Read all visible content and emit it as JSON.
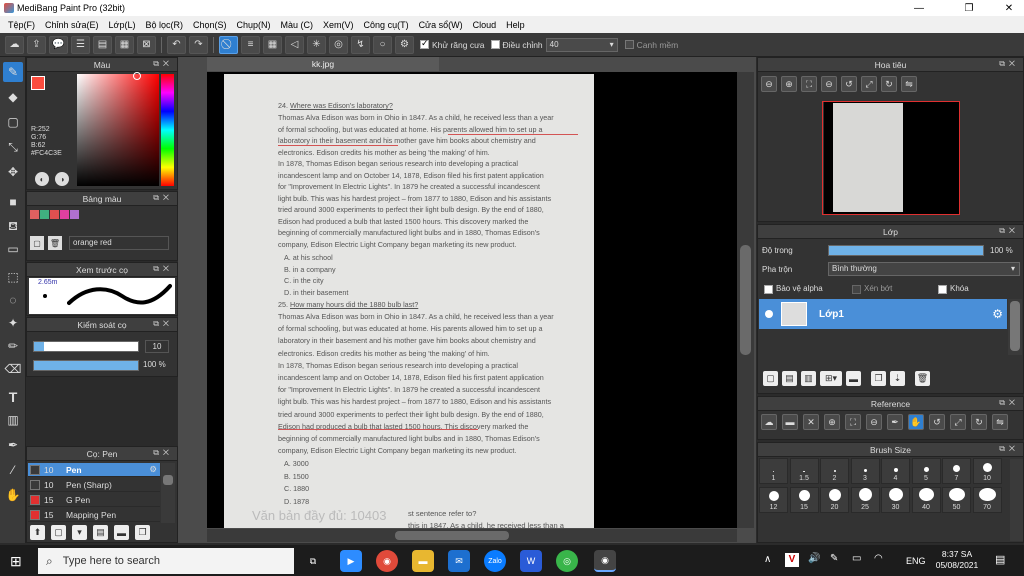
{
  "window": {
    "title": "MediBang Paint Pro (32bit)",
    "min": "—",
    "max": "❐",
    "close": "✕"
  },
  "menu": [
    "Tệp(F)",
    "Chỉnh sửa(E)",
    "Lớp(L)",
    "Bộ lọc(R)",
    "Chọn(S)",
    "Chụp(N)",
    "Màu (C)",
    "Xem(V)",
    "Công cụ(T)",
    "Cửa sổ(W)",
    "Cloud",
    "Help"
  ],
  "toolbar": {
    "antialias_label": "Khử răng cưa",
    "adjust_label": "Điều chỉnh",
    "adjust_value": "40",
    "smooth_label": "Canh mềm"
  },
  "color_panel": {
    "title": "Màu",
    "r": "R:252",
    "g": "G:76",
    "b": "B:62",
    "hex": "#FC4C3E",
    "primary": "#FC4C3E",
    "secondary": "#2ecc9a"
  },
  "palette_panel": {
    "title": "Bảng màu",
    "colors": [
      "#e06060",
      "#40b080",
      "#e05050",
      "#e040a0",
      "#b070d0"
    ],
    "selected_name": "orange red"
  },
  "brush_preview_panel": {
    "title": "Xem trước cọ",
    "size_label": "2.65m"
  },
  "brush_control_panel": {
    "title": "Kiểm soát cọ",
    "size_value": "10",
    "opacity_value": "100 %",
    "size_fraction": 0.1,
    "opacity_fraction": 1.0
  },
  "pen_panel": {
    "title": "Cọ: Pen",
    "items": [
      {
        "size": "10",
        "name": "Pen",
        "color": "#3a3a3a",
        "selected": true
      },
      {
        "size": "10",
        "name": "Pen (Sharp)",
        "color": "#3a3a3a",
        "selected": false
      },
      {
        "size": "15",
        "name": "G Pen",
        "color": "#e03030",
        "selected": false
      },
      {
        "size": "15",
        "name": "Mapping Pen",
        "color": "#e03030",
        "selected": false
      }
    ]
  },
  "document": {
    "tab": "kk.jpg",
    "q24_num": "24.",
    "q24": "Where was Edison's laboratory?",
    "p1": [
      "Thomas Alva Edison was born in Ohio in 1847. As a child, he received less than a year",
      "of formal schooling, but was educated at home. His parents allowed him to set up a",
      "laboratory in their basement and his mother gave him books about chemistry and",
      "electronics. Edison credits his mother as being 'the making' of him.",
      "In 1878, Thomas Edison began serious research into developing a practical",
      "incandescent lamp and on October 14, 1878, Edison filed his first patent application",
      "for \"Improvement In Electric Lights\". In 1879 he created a successful incandescent",
      "light bulb. This was his hardest project – from 1877 to 1880, Edison and his assistants",
      "tried around 3000 experiments to perfect their light bulb design. By the end of 1880,",
      "Edison had produced a bulb that lasted 1500 hours. This discovery marked the",
      "beginning of commercially manufactured light bulbs and in 1880, Thomas Edison's",
      "company, Edison Electric Light Company began marketing its new product."
    ],
    "opts24": [
      "A. at his school",
      "B. in a company",
      "C. in the city",
      "D. in their basement"
    ],
    "q25_num": "25.",
    "q25": "How many hours did the 1880 bulb last?",
    "p2": [
      "Thomas Alva Edison was born in Ohio in 1847. As a child, he received less than a year",
      "of formal schooling, but was educated at home. His parents allowed him to set up a",
      "laboratory in their basement and his mother gave him books about chemistry and",
      "electronics. Edison credits his mother as being 'the making' of him.",
      "In 1878, Thomas Edison began serious research into developing a practical",
      "incandescent lamp and on October 14, 1878, Edison filed his first patent application",
      "for \"Improvement In Electric Lights\". In 1879 he created a successful incandescent",
      "light bulb. This was his hardest project – from 1877 to 1880, Edison and his assistants",
      "tried around 3000 experiments to perfect their light bulb design. By the end of 1880,",
      "Edison had produced a bulb that lasted 1500 hours. This discovery marked the",
      "beginning of commercially manufactured light bulbs and in 1880, Thomas Edison's",
      "company, Edison Electric Light Company began marketing its new product."
    ],
    "opts25": [
      "A. 3000",
      "B. 1500",
      "C. 1880",
      "D. 1878"
    ],
    "watermark": "Văn bản đầy đủ: 10403",
    "tail1": "st sentence refer to?",
    "tail2": "this in 1847. As a child, he received less than a"
  },
  "navigator_panel": {
    "title": "Hoa tiêu"
  },
  "layer_panel": {
    "title": "Lớp",
    "opacity_label": "Độ trong",
    "opacity_value": "100 %",
    "opacity_fraction": 1.0,
    "blend_label": "Pha trộn",
    "blend_value": "Bình thường",
    "protect_alpha": "Bảo vệ alpha",
    "clipping": "Xén bớt",
    "lock": "Khóa",
    "layer_name": "Lớp1"
  },
  "reference_panel": {
    "title": "Reference"
  },
  "brush_size_panel": {
    "title": "Brush Size",
    "row1": [
      "1",
      "1.5",
      "2",
      "3",
      "4",
      "5",
      "7",
      "10"
    ],
    "row2": [
      "12",
      "15",
      "20",
      "25",
      "30",
      "40",
      "50",
      "70"
    ]
  },
  "taskbar": {
    "search_placeholder": "Type here to search",
    "lang": "ENG",
    "time": "8:37 SA",
    "date": "05/08/2021"
  }
}
